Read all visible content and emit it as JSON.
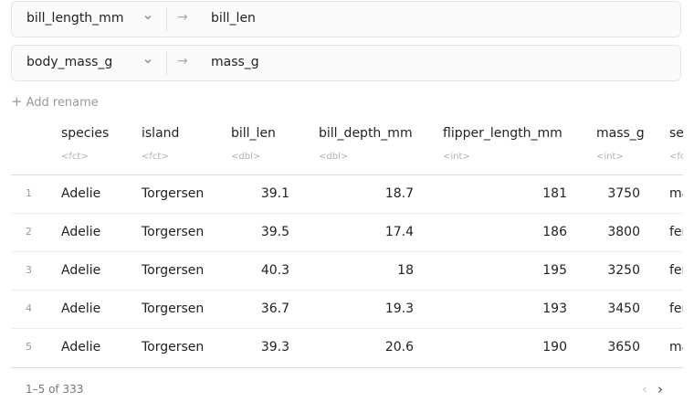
{
  "renames": [
    {
      "from": "bill_length_mm",
      "arrow": "→",
      "to": "bill_len"
    },
    {
      "from": "body_mass_g",
      "arrow": "→",
      "to": "mass_g"
    }
  ],
  "add_rename": {
    "icon": "+",
    "label": "Add rename"
  },
  "table": {
    "columns": [
      {
        "name": "species",
        "type": "<fct>"
      },
      {
        "name": "island",
        "type": "<fct>"
      },
      {
        "name": "bill_len",
        "type": "<dbl>"
      },
      {
        "name": "bill_depth_mm",
        "type": "<dbl>"
      },
      {
        "name": "flipper_length_mm",
        "type": "<int>"
      },
      {
        "name": "mass_g",
        "type": "<int>"
      },
      {
        "name": "sex",
        "type": "<fct>"
      }
    ],
    "rows": [
      {
        "n": "1",
        "cells": [
          "Adelie",
          "Torgersen",
          "39.1",
          "18.7",
          "181",
          "3750",
          "male"
        ]
      },
      {
        "n": "2",
        "cells": [
          "Adelie",
          "Torgersen",
          "39.5",
          "17.4",
          "186",
          "3800",
          "female"
        ]
      },
      {
        "n": "3",
        "cells": [
          "Adelie",
          "Torgersen",
          "40.3",
          "18",
          "195",
          "3250",
          "female"
        ]
      },
      {
        "n": "4",
        "cells": [
          "Adelie",
          "Torgersen",
          "36.7",
          "19.3",
          "193",
          "3450",
          "female"
        ]
      },
      {
        "n": "5",
        "cells": [
          "Adelie",
          "Torgersen",
          "39.3",
          "20.6",
          "190",
          "3650",
          "male"
        ]
      }
    ]
  },
  "pager": {
    "info": "1–5 of 333",
    "prev": "‹",
    "next": "›"
  }
}
